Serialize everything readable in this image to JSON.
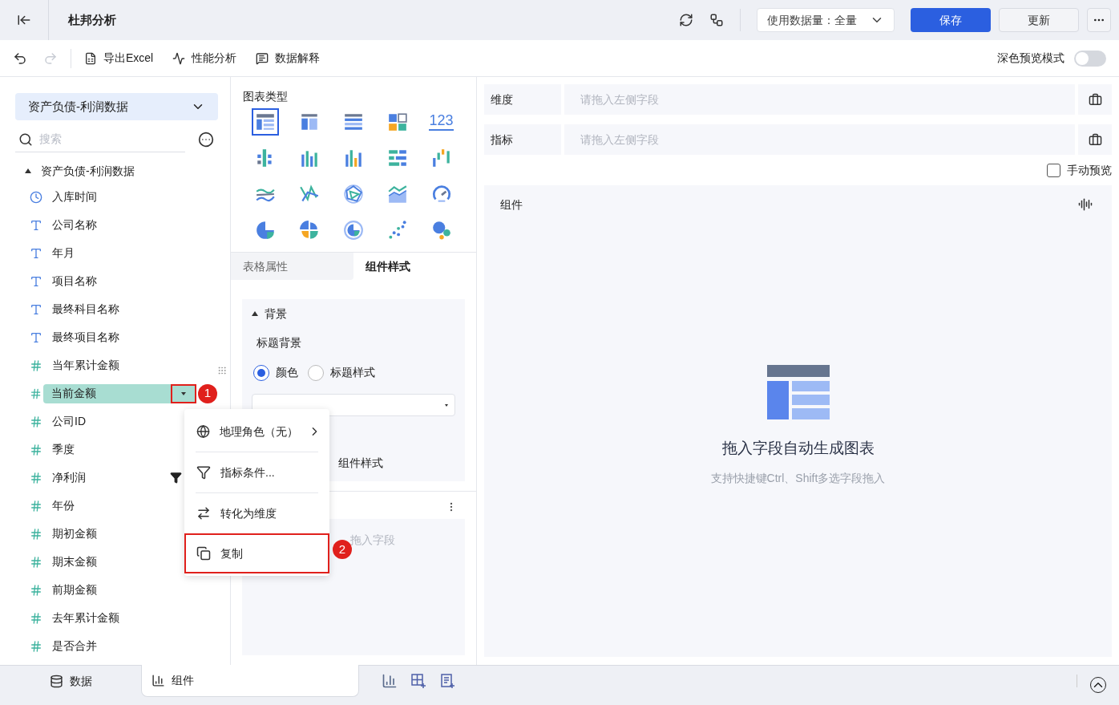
{
  "header": {
    "title": "杜邦分析",
    "data_amount": "使用数据量：全量",
    "save": "保存",
    "update": "更新"
  },
  "toolbar": {
    "undo_disabled": false,
    "redo_disabled": true,
    "items": [
      {
        "label": "导出Excel",
        "kind": "excel"
      },
      {
        "label": "性能分析",
        "kind": "perf"
      },
      {
        "label": "数据解释",
        "kind": "explain"
      }
    ],
    "dark_preview": {
      "label": "深色预览模式",
      "on": false
    }
  },
  "data_panel": {
    "dataset": "资产负债-利润数据",
    "search_placeholder": "搜索",
    "tree": {
      "label": "资产负债-利润数据",
      "expanded": true,
      "children": [
        {
          "label": "入库时间",
          "kind": "time",
          "selected": false,
          "filtered": false
        },
        {
          "label": "公司名称",
          "kind": "text",
          "selected": false,
          "filtered": false
        },
        {
          "label": "年月",
          "kind": "text",
          "selected": false,
          "filtered": false
        },
        {
          "label": "项目名称",
          "kind": "text",
          "selected": false,
          "filtered": false
        },
        {
          "label": "最终科目名称",
          "kind": "text",
          "selected": false,
          "filtered": false
        },
        {
          "label": "最终项目名称",
          "kind": "text",
          "selected": false,
          "filtered": false
        },
        {
          "label": "当年累计金额",
          "kind": "number",
          "selected": false,
          "filtered": false
        },
        {
          "label": "当前金额",
          "kind": "number",
          "selected": true,
          "filtered": false
        },
        {
          "label": "公司ID",
          "kind": "number",
          "selected": false,
          "filtered": false
        },
        {
          "label": "季度",
          "kind": "number",
          "selected": false,
          "filtered": false
        },
        {
          "label": "净利润",
          "kind": "number",
          "selected": false,
          "filtered": true
        },
        {
          "label": "年份",
          "kind": "number",
          "selected": false,
          "filtered": false
        },
        {
          "label": "期初金额",
          "kind": "number",
          "selected": false,
          "filtered": false
        },
        {
          "label": "期末金额",
          "kind": "number",
          "selected": false,
          "filtered": false
        },
        {
          "label": "前期金额",
          "kind": "number",
          "selected": false,
          "filtered": false
        },
        {
          "label": "去年累计金额",
          "kind": "number",
          "selected": false,
          "filtered": false
        },
        {
          "label": "是否合并",
          "kind": "number",
          "selected": false,
          "filtered": false
        }
      ]
    }
  },
  "annotations": [
    {
      "label": "1"
    },
    {
      "label": "2"
    }
  ],
  "context_menu": {
    "items": [
      {
        "label": "地理角色（无）",
        "kind": "globe",
        "submenu": true,
        "highlighted": false
      },
      {
        "label": "指标条件...",
        "kind": "filter",
        "submenu": false,
        "highlighted": false
      },
      {
        "label": "转化为维度",
        "kind": "swap",
        "submenu": false,
        "highlighted": false
      },
      {
        "label": "复制",
        "kind": "copy",
        "submenu": false,
        "highlighted": true
      }
    ]
  },
  "chart_types": {
    "title": "图表类型",
    "items": [
      {
        "kind": "table",
        "selected": true
      },
      {
        "kind": "cross-table",
        "selected": false
      },
      {
        "kind": "detail-table",
        "selected": false
      },
      {
        "kind": "block",
        "selected": false
      },
      {
        "kind": "number",
        "label": "123",
        "selected": false
      },
      {
        "kind": "grouped-bar",
        "selected": false
      },
      {
        "kind": "bar",
        "selected": false
      },
      {
        "kind": "multi-bar",
        "selected": false
      },
      {
        "kind": "horizontal-bar",
        "selected": false
      },
      {
        "kind": "waterfall",
        "selected": false
      },
      {
        "kind": "line",
        "selected": false
      },
      {
        "kind": "multi-line",
        "selected": false
      },
      {
        "kind": "radar",
        "selected": false
      },
      {
        "kind": "area",
        "selected": false
      },
      {
        "kind": "gauge",
        "selected": false
      },
      {
        "kind": "pie",
        "selected": false
      },
      {
        "kind": "rose",
        "selected": false
      },
      {
        "kind": "ring",
        "selected": false
      },
      {
        "kind": "scatter",
        "selected": false
      },
      {
        "kind": "bubble",
        "selected": false
      }
    ]
  },
  "property_tabs": [
    {
      "label": "表格属性",
      "selected": false
    },
    {
      "label": "组件样式",
      "selected": true
    }
  ],
  "style_panel": {
    "section": {
      "label": "背景",
      "expanded": true
    },
    "subtitle": "标题背景",
    "radios": [
      {
        "label": "颜色",
        "selected": true
      },
      {
        "label": "标题样式",
        "selected": false
      }
    ],
    "second_heading": "组件样式",
    "drop_hint": "拖入字段"
  },
  "fields": [
    {
      "label": "维度",
      "placeholder": "请拖入左侧字段"
    },
    {
      "label": "指标",
      "placeholder": "请拖入左侧字段"
    }
  ],
  "manual_preview": {
    "label": "手动预览",
    "checked": false
  },
  "canvas": {
    "title": "组件",
    "empty_title": "拖入字段自动生成图表",
    "empty_hint": "支持快捷键Ctrl、Shift多选字段拖入"
  },
  "bottom_tabs": [
    {
      "label": "数据",
      "kind": "data",
      "selected": false
    },
    {
      "label": "组件",
      "kind": "component",
      "selected": true
    }
  ]
}
